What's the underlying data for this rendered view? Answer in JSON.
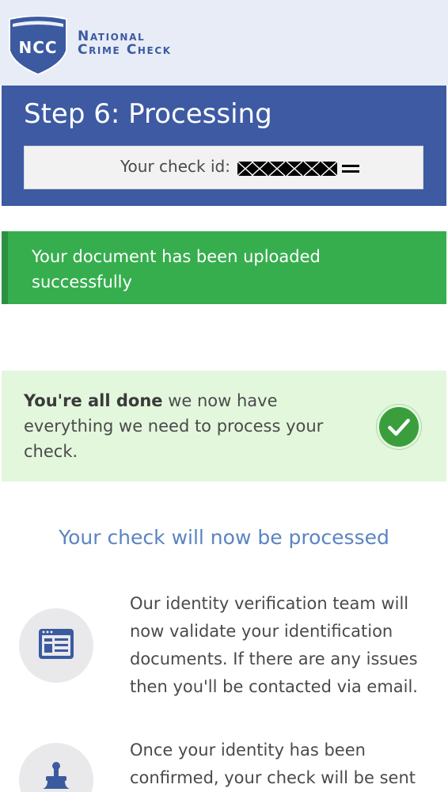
{
  "header": {
    "logo_abbr": "NCC",
    "brand_line1": "National",
    "brand_line2": "Crime Check"
  },
  "step": {
    "title": "Step 6: Processing",
    "check_id_label": "Your check id:",
    "check_id_value": "XXXXXX="
  },
  "upload_banner": {
    "message": "Your document has been uploaded successfully"
  },
  "done": {
    "bold": "You're all done",
    "rest": " we now have everything we need to process your check."
  },
  "process": {
    "heading": "Your check will now be processed",
    "items": [
      {
        "icon": "browser-window-icon",
        "text": "Our identity verification team will now validate your identification documents. If there are any issues then you'll be contacted via email."
      },
      {
        "icon": "stamp-icon",
        "text": "Once your identity has been confirmed, your check will be sent"
      }
    ]
  },
  "colors": {
    "header_bg": "#e8ecf7",
    "brand_blue": "#3d5aa3",
    "success_green": "#36ae4e",
    "done_bg": "#e3f7dd",
    "heading_blue": "#5b84c1"
  }
}
